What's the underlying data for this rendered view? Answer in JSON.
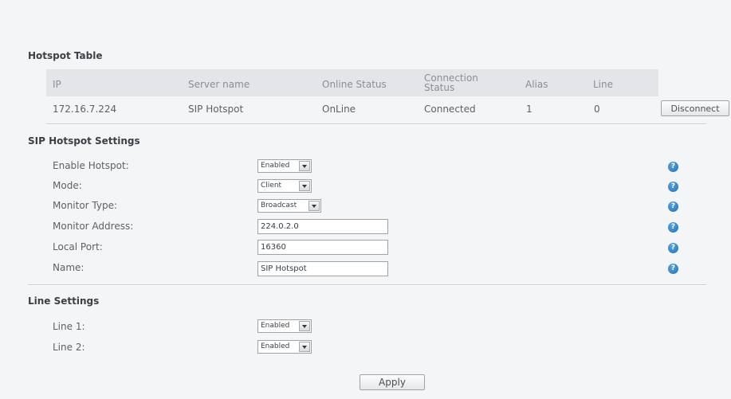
{
  "hotspot_table": {
    "title": "Hotspot Table",
    "headers": [
      "IP",
      "Server name",
      "Online Status",
      "Connection Status",
      "Alias",
      "Line"
    ],
    "rows": [
      {
        "ip": "172.16.7.224",
        "server_name": "SIP Hotspot",
        "online_status": "OnLine",
        "connection_status": "Connected",
        "alias": "1",
        "line": "0",
        "action_label": "Disconnect"
      }
    ]
  },
  "sip_hotspot_settings": {
    "title": "SIP Hotspot Settings",
    "enable_hotspot": {
      "label": "Enable Hotspot:",
      "value": "Enabled"
    },
    "mode": {
      "label": "Mode:",
      "value": "Client"
    },
    "monitor_type": {
      "label": "Monitor Type:",
      "value": "Broadcast"
    },
    "monitor_address": {
      "label": "Monitor Address:",
      "value": "224.0.2.0"
    },
    "local_port": {
      "label": "Local Port:",
      "value": "16360"
    },
    "name": {
      "label": "Name:",
      "value": "SIP Hotspot"
    },
    "help_glyph": "?"
  },
  "line_settings": {
    "title": "Line Settings",
    "line1": {
      "label": "Line 1:",
      "value": "Enabled"
    },
    "line2": {
      "label": "Line 2:",
      "value": "Enabled"
    }
  },
  "apply_label": "Apply",
  "icons": {
    "help": "help-icon",
    "dropdown": "chevron-down-icon"
  },
  "colors": {
    "help_icon": "#1f6fb8",
    "header_bg": "#e3e5e8",
    "page_bg": "#f4f5f7"
  }
}
